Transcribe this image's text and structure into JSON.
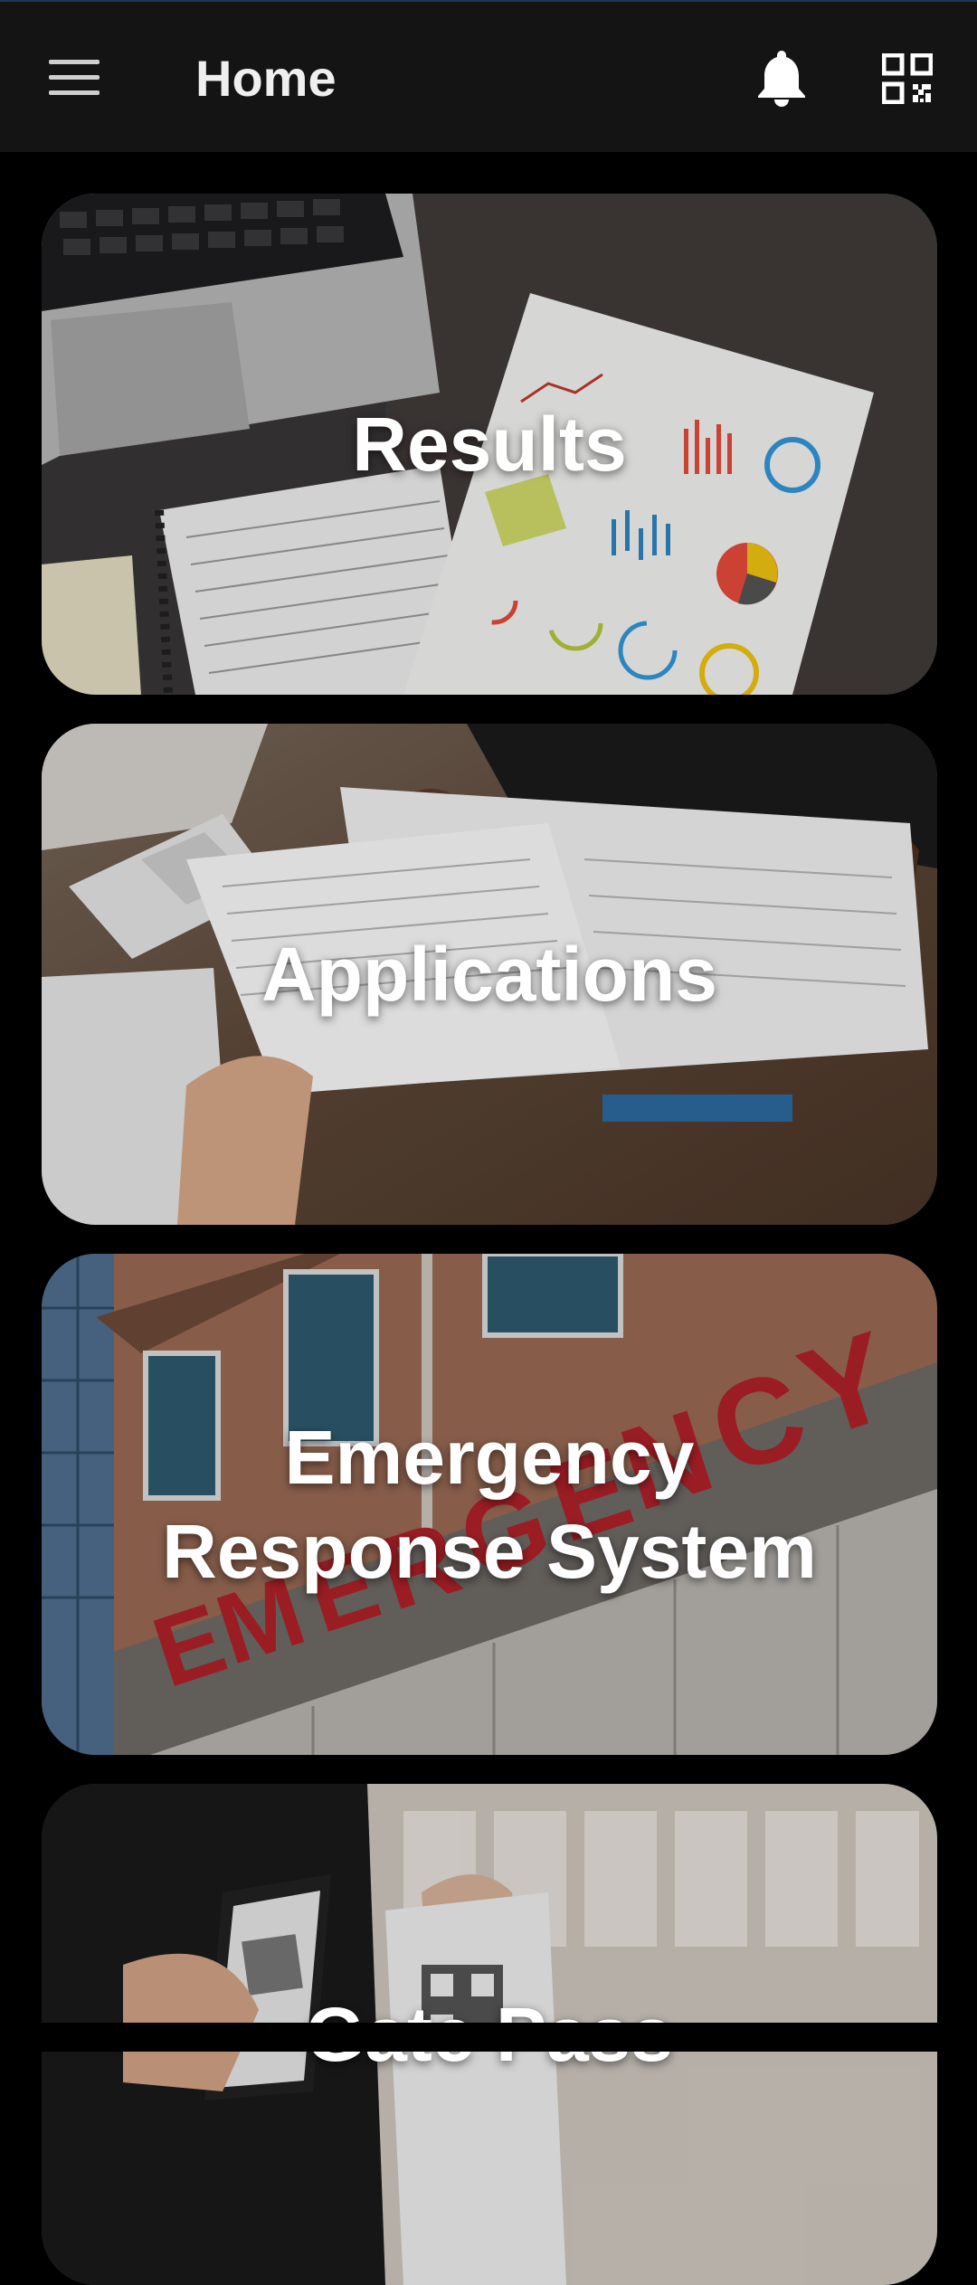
{
  "app_bar": {
    "title": "Home",
    "menu_icon": "hamburger-menu-icon",
    "notification_icon": "bell-icon",
    "scan_icon": "qr-code-icon"
  },
  "cards": [
    {
      "label": "Results",
      "image": "desk-charts-image"
    },
    {
      "label": "Applications",
      "image": "paperwork-handover-image"
    },
    {
      "label": "Emergency\nResponse System",
      "image": "emergency-building-image"
    },
    {
      "label": "Gate Pass",
      "image": "phone-qr-scan-image"
    }
  ],
  "colors": {
    "app_bar_bg": "#141414",
    "page_bg": "#000000",
    "text": "#ffffff"
  }
}
